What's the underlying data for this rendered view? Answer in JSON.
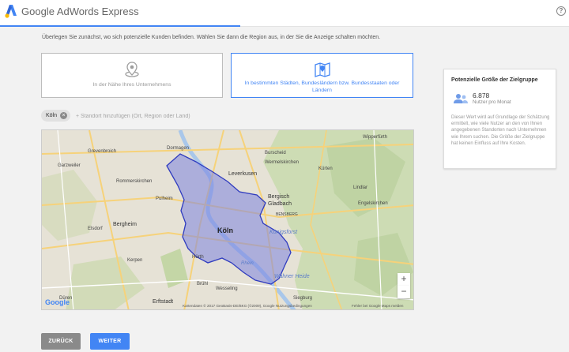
{
  "app": {
    "title": "Google AdWords Express",
    "help_glyph": "?"
  },
  "instruction": "Überlegen Sie zunächst, wo sich potenzielle Kunden befinden. Wählen Sie dann die Region aus, in der Sie die Anzeige schalten möchten.",
  "options": {
    "near_business": "In der Nähe Ihres Unternehmens",
    "specific_areas": "In bestimmten Städten, Bundesländern bzw. Bundesstaaten oder Ländern"
  },
  "location": {
    "chip_label": "Köln",
    "chip_close_glyph": "×",
    "input_placeholder": "+ Standort hinzufügen (Ort, Region oder Land)"
  },
  "audience": {
    "title": "Potenzielle Größe der Zielgruppe",
    "count": "6.878",
    "unit": "Nutzer pro Monat",
    "description": "Dieser Wert wird auf Grundlage der Schätzung ermittelt, wie viele Nutzer an den von Ihnen angegebenen Standorten nach Unternehmen wie Ihrem suchen. Die Größe der Zielgruppe hat keinen Einfluss auf Ihre Kosten."
  },
  "map": {
    "labels": {
      "grevenbroich": "Grevenbroich",
      "dormagen": "Dormagen",
      "burscheid": "Burscheid",
      "wipperfuerth": "Wipperfürth",
      "garzweiler": "Garzweiler",
      "rommerskirchen": "Rommerskirchen",
      "leverkusen": "Leverkusen",
      "wermelskirchen": "Wermelskirchen",
      "kuerten": "Kürten",
      "bergisch_gladbach": "Bergisch Gladbach",
      "lindlar": "Lindlar",
      "pulheim": "Pulheim",
      "engelskirchen": "Engelskirchen",
      "bensberg": "BENSBERG",
      "bergheim": "Bergheim",
      "elsdorf": "Elsdorf",
      "koeln": "Köln",
      "koenigsforst": "Königsforst",
      "kerpen": "Kerpen",
      "huerth": "Hürth",
      "wahner_heide": "Wahner Heide",
      "bruehl": "Brühl",
      "wesseling": "Wesseling",
      "dueren": "Düren",
      "erftstadt": "Erftstadt",
      "siegburg": "Siegburg",
      "rhein": "Rhein"
    },
    "zoom_in": "+",
    "zoom_out": "−",
    "logo": "Google",
    "attribution": "Kartendaten © 2017 GeoBasis-DE/BKG (©2009), Google   Nutzungsbedingungen",
    "report": "Fehler bei Google Maps melden"
  },
  "buttons": {
    "back": "ZURÜCK",
    "next": "WEITER"
  },
  "colors": {
    "accent": "#4285f4",
    "region_fill": "#7b83e0",
    "back_button": "#8a8a8a"
  }
}
